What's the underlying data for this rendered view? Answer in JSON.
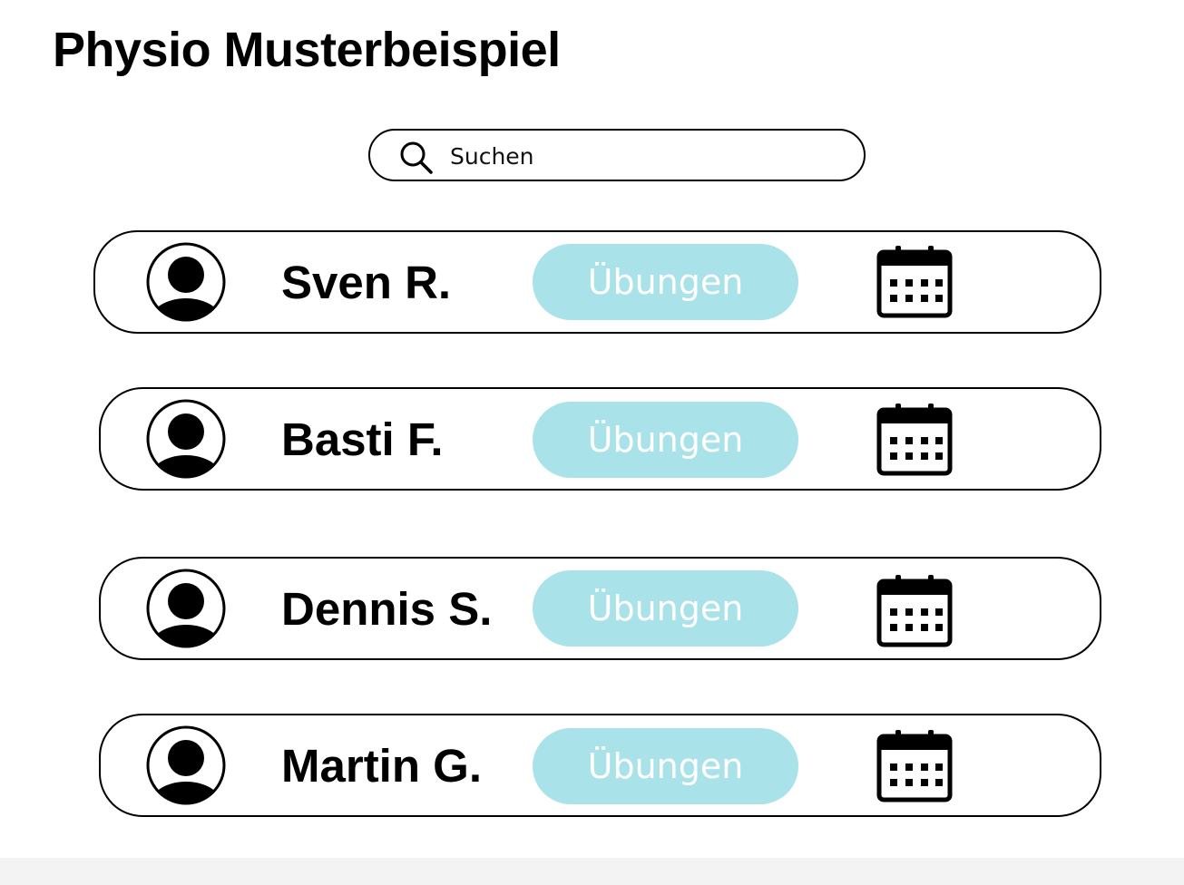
{
  "header": {
    "title": "Physio Musterbeispiel"
  },
  "search": {
    "placeholder": "Suchen",
    "icon": "search-icon"
  },
  "patients": [
    {
      "name": "Sven R.",
      "button_label": "Übungen"
    },
    {
      "name": "Basti F.",
      "button_label": "Übungen"
    },
    {
      "name": "Dennis S.",
      "button_label": "Übungen"
    },
    {
      "name": "Martin G.",
      "button_label": "Übungen"
    }
  ],
  "icons": {
    "avatar": "user-avatar-icon",
    "calendar": "calendar-icon"
  },
  "colors": {
    "accent": "#a9e2e8",
    "button_text": "#ffffff",
    "border": "#000000",
    "background": "#ffffff"
  }
}
